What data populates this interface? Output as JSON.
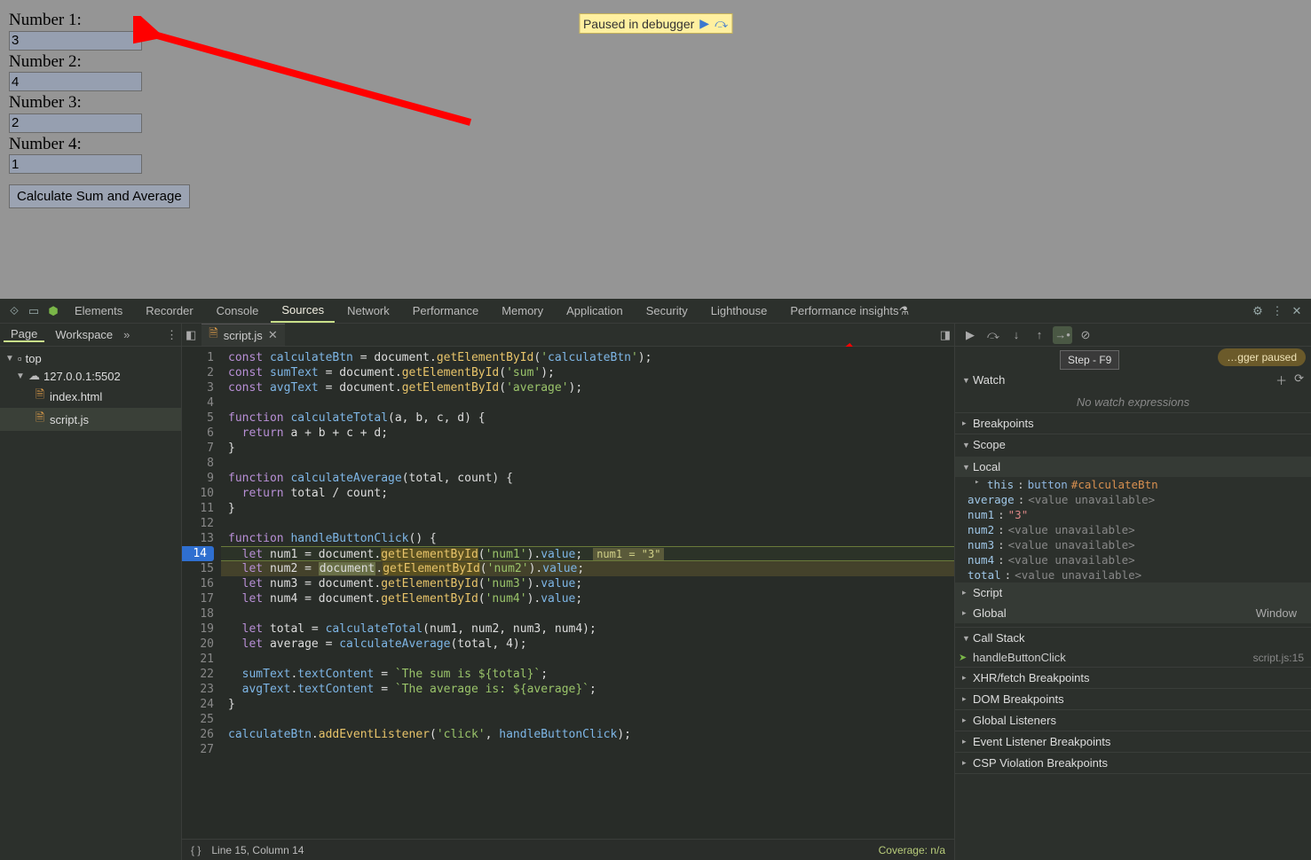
{
  "page": {
    "labels": {
      "n1": "Number 1:",
      "n2": "Number 2:",
      "n3": "Number 3:",
      "n4": "Number 4:"
    },
    "values": {
      "n1": "3",
      "n2": "4",
      "n3": "2",
      "n4": "1"
    },
    "button": "Calculate Sum and Average",
    "debugger_pill": "Paused in debugger"
  },
  "devtools": {
    "tabs": [
      "Elements",
      "Recorder",
      "Console",
      "Sources",
      "Network",
      "Performance",
      "Memory",
      "Application",
      "Security",
      "Lighthouse",
      "Performance insights"
    ],
    "active_tab": "Sources",
    "nav": {
      "tabs": [
        "Page",
        "Workspace"
      ],
      "top": "top",
      "host": "127.0.0.1:5502",
      "files": [
        "index.html",
        "script.js"
      ],
      "selected": "script.js"
    },
    "editor": {
      "open_file": "script.js",
      "lines": [
        {
          "n": 1,
          "t": "const calculateBtn = document.getElementById('calculateBtn');"
        },
        {
          "n": 2,
          "t": "const sumText = document.getElementById('sum');"
        },
        {
          "n": 3,
          "t": "const avgText = document.getElementById('average');"
        },
        {
          "n": 4,
          "t": ""
        },
        {
          "n": 5,
          "t": "function calculateTotal(a, b, c, d) {"
        },
        {
          "n": 6,
          "t": "  return a + b + c + d;"
        },
        {
          "n": 7,
          "t": "}"
        },
        {
          "n": 8,
          "t": ""
        },
        {
          "n": 9,
          "t": "function calculateAverage(total, count) {"
        },
        {
          "n": 10,
          "t": "  return total / count;"
        },
        {
          "n": 11,
          "t": "}"
        },
        {
          "n": 12,
          "t": ""
        },
        {
          "n": 13,
          "t": "function handleButtonClick() {"
        },
        {
          "n": 14,
          "t": "  let num1 = document.getElementById('num1').value;",
          "inline": "num1 = \"3\"",
          "bp": true
        },
        {
          "n": 15,
          "t": "  let num2 = document.getElementById('num2').value;",
          "hl": true
        },
        {
          "n": 16,
          "t": "  let num3 = document.getElementById('num3').value;"
        },
        {
          "n": 17,
          "t": "  let num4 = document.getElementById('num4').value;"
        },
        {
          "n": 18,
          "t": ""
        },
        {
          "n": 19,
          "t": "  let total = calculateTotal(num1, num2, num3, num4);"
        },
        {
          "n": 20,
          "t": "  let average = calculateAverage(total, 4);"
        },
        {
          "n": 21,
          "t": ""
        },
        {
          "n": 22,
          "t": "  sumText.textContent = `The sum is ${total}`;"
        },
        {
          "n": 23,
          "t": "  avgText.textContent = `The average is: ${average}`;"
        },
        {
          "n": 24,
          "t": "}"
        },
        {
          "n": 25,
          "t": ""
        },
        {
          "n": 26,
          "t": "calculateBtn.addEventListener('click', handleButtonClick);"
        },
        {
          "n": 27,
          "t": ""
        }
      ],
      "status": {
        "cursor": "Line 15, Column 14",
        "coverage": "Coverage: n/a"
      }
    },
    "right": {
      "controls_tooltip": "Step - F9",
      "paused": "…gger paused",
      "watch": {
        "title": "Watch",
        "empty": "No watch expressions"
      },
      "breakpoints": "Breakpoints",
      "scope": {
        "title": "Scope",
        "local": "Local",
        "this": {
          "label": "this",
          "type": "button",
          "id": "#calculateBtn"
        },
        "vars": [
          {
            "k": "average",
            "v": "<value unavailable>"
          },
          {
            "k": "num1",
            "v": "\"3\"",
            "str": true
          },
          {
            "k": "num2",
            "v": "<value unavailable>"
          },
          {
            "k": "num3",
            "v": "<value unavailable>"
          },
          {
            "k": "num4",
            "v": "<value unavailable>"
          },
          {
            "k": "total",
            "v": "<value unavailable>"
          }
        ],
        "script": "Script",
        "global": "Global",
        "global_val": "Window"
      },
      "callstack": {
        "title": "Call Stack",
        "frame": "handleButtonClick",
        "loc": "script.js:15"
      },
      "sections": [
        "XHR/fetch Breakpoints",
        "DOM Breakpoints",
        "Global Listeners",
        "Event Listener Breakpoints",
        "CSP Violation Breakpoints"
      ]
    }
  }
}
